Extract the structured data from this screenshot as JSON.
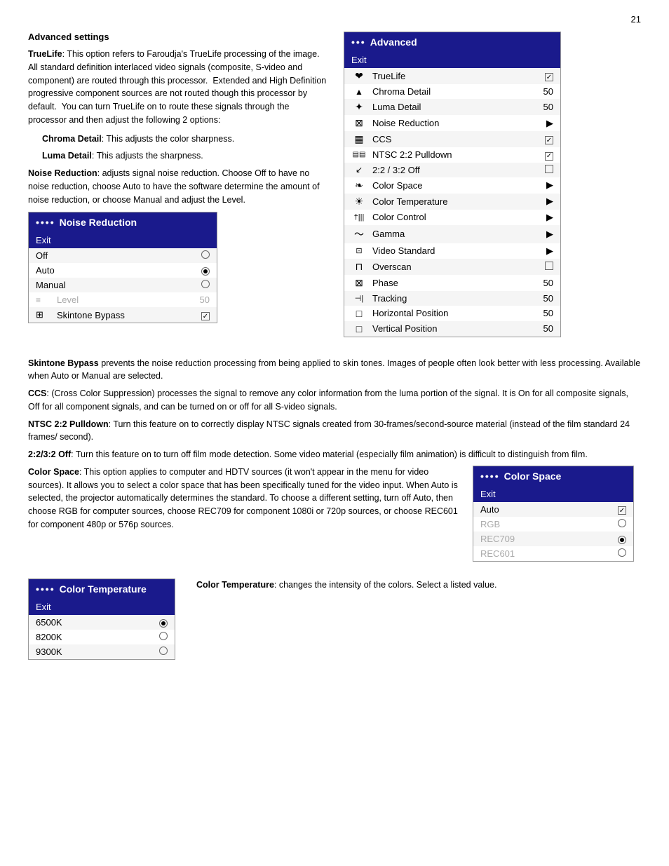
{
  "page": {
    "number": "21"
  },
  "advanced_settings": {
    "heading": "Advanced settings",
    "truelife_text": "TrueLife: This option refers to Faroudja's TrueLife processing of the image. All standard definition interlaced video signals (composite, S-video and component) are routed through this processor.  Extended and High Definition progressive component sources are not routed though this processor by default.  You can turn TrueLife on to route these signals through the processor and then adjust the following 2 options:",
    "chroma_detail_text": "Chroma Detail: This adjusts the color sharpness.",
    "luma_detail_text": "Luma Detail: This adjusts the sharpness.",
    "noise_reduction_text": "Noise Reduction: adjusts signal noise reduction. Choose Off to have no noise reduction, choose Auto to have the software determine the amount of noise reduction, or choose Manual and adjust the Level.",
    "skintone_bypass_text": "Skintone Bypass prevents the noise reduction processing from being applied to skin tones. Images of people often look better with less processing. Available when Auto or Manual are selected.",
    "ccs_text": "CCS: (Cross Color Suppression) processes the signal to remove any color information from the luma portion of the signal. It is On for all composite signals, Off for all component signals, and can be turned on or off for all  S-video signals.",
    "ntsc_text": "NTSC 2:2 Pulldown: Turn this feature on to correctly display NTSC signals created from 30-frames/second-source material (instead of the film standard 24 frames/ second).",
    "two_three_text": "2:2/3:2 Off: Turn this feature on to turn off film mode detection. Some video material (especially film animation) is difficult to distinguish from film.",
    "color_space_text": "Color Space: This option applies to computer and HDTV sources (it won't appear in the menu for video sources). It allows you to select a color space that has been specifically tuned for the video input. When Auto is selected, the projector automatically determines the standard. To choose a different setting, turn off Auto, then choose RGB for computer sources, choose REC709 for component 1080i or 720p sources, or choose REC601 for component 480p or 576p sources.",
    "color_temp_text": "Color Temperature: changes the intensity of the colors. Select a listed value."
  },
  "advanced_menu": {
    "header_dots": "•••",
    "header_title": "Advanced",
    "exit_label": "Exit",
    "items": [
      {
        "icon": "❤",
        "label": "TrueLife",
        "value": "☑",
        "type": "checkbox",
        "checked": true
      },
      {
        "icon": "▲",
        "label": "Chroma Detail",
        "value": "50",
        "type": "number"
      },
      {
        "icon": "✦",
        "label": "Luma Detail",
        "value": "50",
        "type": "number"
      },
      {
        "icon": "⊠",
        "label": "Noise Reduction",
        "value": "▶",
        "type": "arrow"
      },
      {
        "icon": "▦",
        "label": "CCS",
        "value": "☑",
        "type": "checkbox",
        "checked": true
      },
      {
        "icon": "▤",
        "label": "NTSC 2:2 Pulldown",
        "value": "☑",
        "type": "checkbox",
        "checked": true
      },
      {
        "icon": "↙",
        "label": "2:2 / 3:2 Off",
        "value": "☐",
        "type": "checkbox",
        "checked": false
      },
      {
        "icon": "❧",
        "label": "Color Space",
        "value": "▶",
        "type": "arrow"
      },
      {
        "icon": "☀",
        "label": "Color Temperature",
        "value": "▶",
        "type": "arrow"
      },
      {
        "icon": "†",
        "label": "Color Control",
        "value": "▶",
        "type": "arrow"
      },
      {
        "icon": "〜",
        "label": "Gamma",
        "value": "▶",
        "type": "arrow"
      },
      {
        "icon": "⊡",
        "label": "Video Standard",
        "value": "▶",
        "type": "arrow"
      },
      {
        "icon": "⊓",
        "label": "Overscan",
        "value": "☐",
        "type": "checkbox",
        "checked": false
      },
      {
        "icon": "⊠",
        "label": "Phase",
        "value": "50",
        "type": "number"
      },
      {
        "icon": "⊣",
        "label": "Tracking",
        "value": "50",
        "type": "number"
      },
      {
        "icon": "□",
        "label": "Horizontal Position",
        "value": "50",
        "type": "number"
      },
      {
        "icon": "□",
        "label": "Vertical Position",
        "value": "50",
        "type": "number"
      }
    ]
  },
  "noise_reduction_menu": {
    "header_dots": "••••",
    "header_title": "Noise Reduction",
    "exit_label": "Exit",
    "items": [
      {
        "label": "Off",
        "type": "radio",
        "checked": false
      },
      {
        "label": "Auto",
        "type": "radio",
        "checked": true
      },
      {
        "label": "Manual",
        "type": "radio",
        "checked": false
      },
      {
        "label": "Level",
        "value": "50",
        "type": "number",
        "disabled": true
      }
    ],
    "skintone_icon": "⊞",
    "skintone_label": "Skintone Bypass",
    "skintone_value": "☑",
    "skintone_checked": true
  },
  "color_space_menu": {
    "header_dots": "••••",
    "header_title": "Color Space",
    "exit_label": "Exit",
    "items": [
      {
        "label": "Auto",
        "type": "checkbox",
        "checked": true
      },
      {
        "label": "RGB",
        "type": "radio",
        "checked": false,
        "disabled": true
      },
      {
        "label": "REC709",
        "type": "radio",
        "checked": true,
        "disabled": true
      },
      {
        "label": "REC601",
        "type": "radio",
        "checked": false,
        "disabled": true
      }
    ]
  },
  "color_temp_menu": {
    "header_dots": "••••",
    "header_title": "Color Temperature",
    "exit_label": "Exit",
    "items": [
      {
        "label": "6500K",
        "type": "radio",
        "checked": true
      },
      {
        "label": "8200K",
        "type": "radio",
        "checked": false
      },
      {
        "label": "9300K",
        "type": "radio",
        "checked": false
      }
    ]
  }
}
